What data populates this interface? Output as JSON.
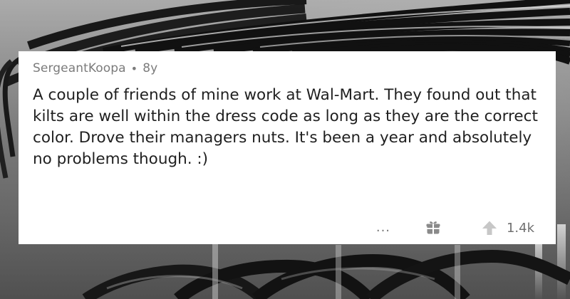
{
  "comment": {
    "author": "SergeantKoopa",
    "separator": "•",
    "age": "8y",
    "body": "A couple of friends of mine work at Wal-Mart. They found out that kilts are well within the dress code as long as they are the correct color. Drove their managers nuts. It's been a year and absolutely no problems though. :)",
    "actions": {
      "more_label": "...",
      "award_icon": "gift-icon",
      "upvote_icon": "upvote-arrow-icon",
      "score": "1.4k"
    }
  },
  "colors": {
    "card": "#ffffff",
    "meta_text": "#7b7b7b",
    "body_text": "#1f1f1f",
    "icon": "#8a8a8a"
  },
  "background": {
    "subject": "clothes-hangers-photo"
  }
}
